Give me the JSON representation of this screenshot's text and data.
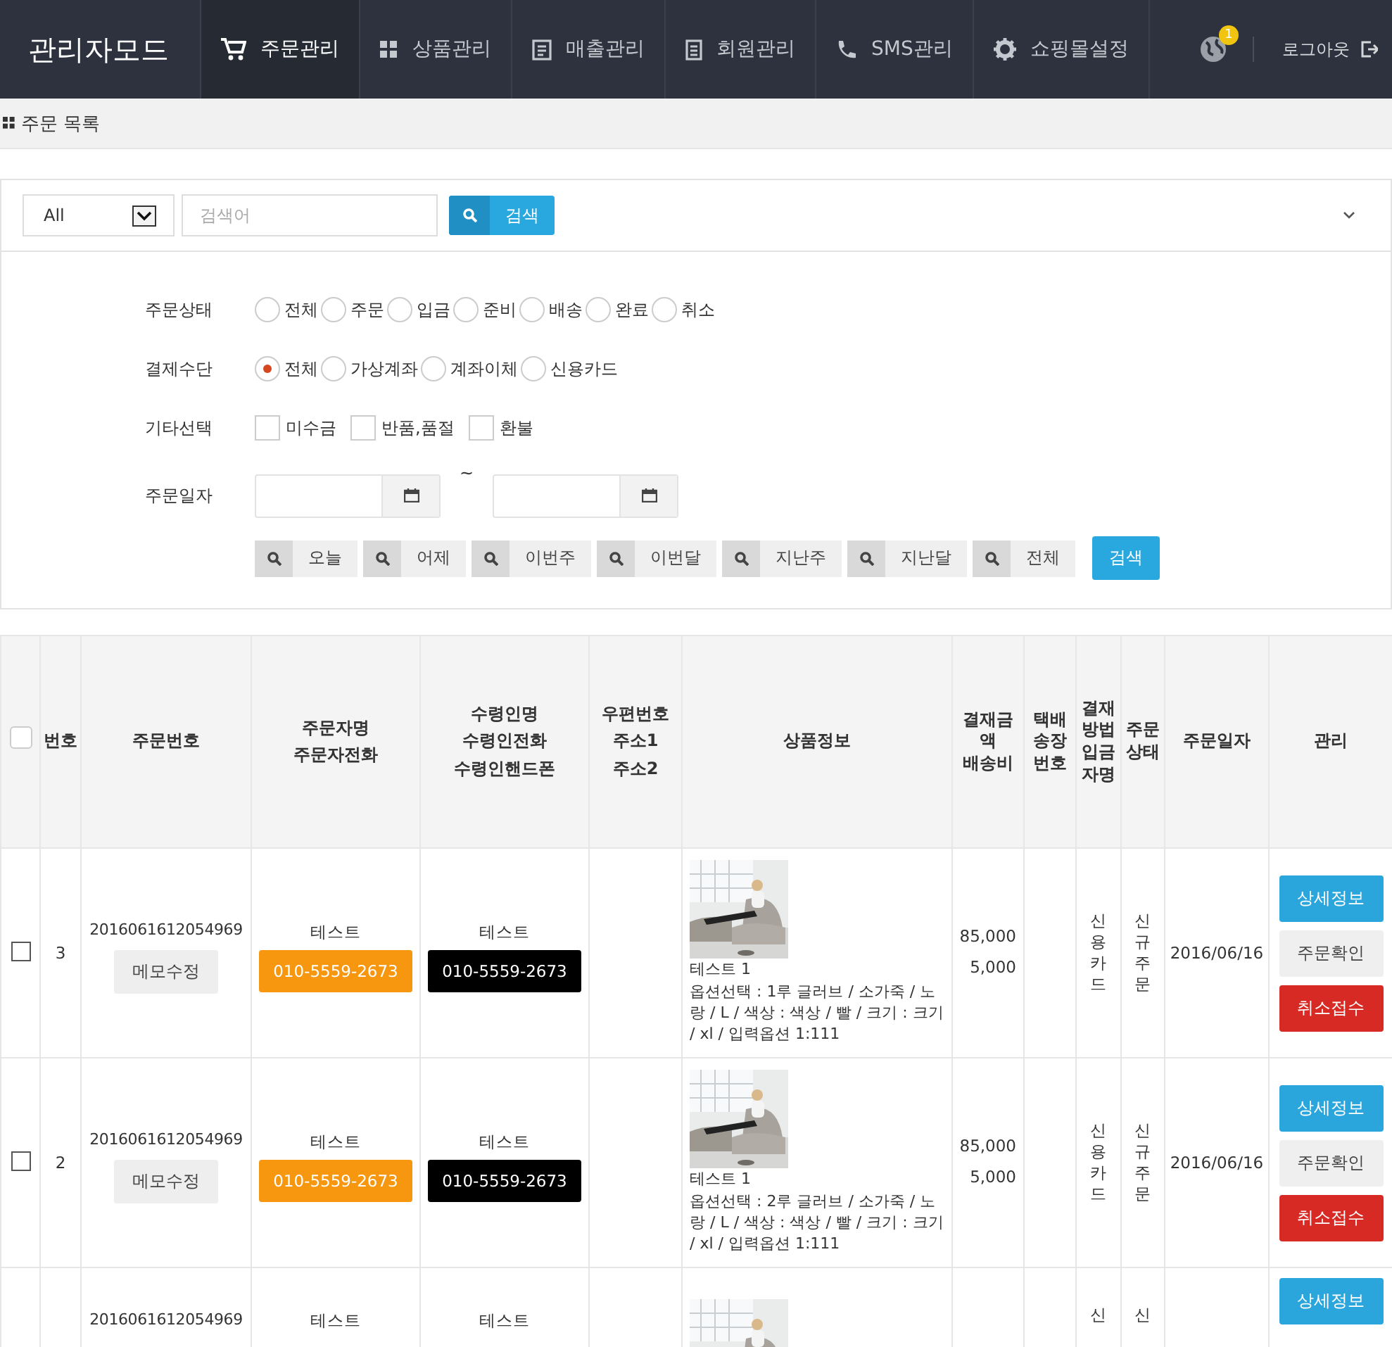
{
  "nav": {
    "brand": "관리자모드",
    "items": [
      {
        "label": "주문관리",
        "selected": true
      },
      {
        "label": "상품관리",
        "selected": false
      },
      {
        "label": "매출관리",
        "selected": false
      },
      {
        "label": "회원관리",
        "selected": false
      },
      {
        "label": "SMS관리",
        "selected": false
      },
      {
        "label": "쇼핑몰설정",
        "selected": false
      }
    ],
    "notification_count": "1",
    "logout": "로그아웃"
  },
  "page_title": "주문 목록",
  "search": {
    "scope": "All",
    "placeholder": "검색어",
    "button": "검색"
  },
  "filters": {
    "order_status": {
      "label": "주문상태",
      "options": [
        {
          "label": "전체",
          "selected": false
        },
        {
          "label": "주문",
          "selected": false
        },
        {
          "label": "입금",
          "selected": false
        },
        {
          "label": "준비",
          "selected": false
        },
        {
          "label": "배송",
          "selected": false
        },
        {
          "label": "완료",
          "selected": false
        },
        {
          "label": "취소",
          "selected": false
        }
      ]
    },
    "payment": {
      "label": "결제수단",
      "options": [
        {
          "label": "전체",
          "selected": true
        },
        {
          "label": "가상계좌",
          "selected": false
        },
        {
          "label": "계좌이체",
          "selected": false
        },
        {
          "label": "신용카드",
          "selected": false
        }
      ]
    },
    "other": {
      "label": "기타선택",
      "options": [
        {
          "label": "미수금",
          "checked": false
        },
        {
          "label": "반품,품절",
          "checked": false
        },
        {
          "label": "환불",
          "checked": false
        }
      ]
    },
    "date": {
      "label": "주문일자",
      "separator": "~"
    },
    "quick_ranges": [
      "오늘",
      "어제",
      "이번주",
      "이번달",
      "지난주",
      "지난달",
      "전체"
    ],
    "search_button": "검색"
  },
  "table": {
    "select_all_checked": false,
    "columns": [
      [
        "번호"
      ],
      [
        "주문번호"
      ],
      [
        "주문자명",
        "주문자전화"
      ],
      [
        "수령인명",
        "수령인전화",
        "수령인핸드폰"
      ],
      [
        "우편번호",
        "주소1",
        "주소2"
      ],
      [
        "상품정보"
      ],
      [
        "결재금액",
        "배송비"
      ],
      [
        "택배송장번호"
      ],
      [
        "결재방법입금자명"
      ],
      [
        "주문상태"
      ],
      [
        "주문일자"
      ],
      [
        "관리"
      ]
    ],
    "rows": [
      {
        "checked": false,
        "no": "3",
        "order_no": "2016061612054969",
        "memo_button": "메모수정",
        "orderer_name": "테스트",
        "orderer_phone": "010-5559-2673",
        "receiver_name": "테스트",
        "receiver_phone": "010-5559-2673",
        "product": {
          "kind": "picture",
          "name": "테스트 1",
          "options": "옵션선택 : 1루 글러브 / 소가죽 / 노랑 / L / 색상 : 색상 / 빨 / 크기 : 크기 / xl / 입력옵션 1:111"
        },
        "amount": "85,000",
        "shipping": "5,000",
        "payment": "신용카드",
        "status": "신규주문",
        "date": "2016/06/16",
        "actions": [
          {
            "kind": "detail",
            "label": "상세정보"
          },
          {
            "kind": "confirm",
            "label": "주문확인"
          },
          {
            "kind": "cancel",
            "label": "취소접수"
          }
        ]
      },
      {
        "checked": false,
        "no": "2",
        "order_no": "2016061612054969",
        "memo_button": "메모수정",
        "orderer_name": "테스트",
        "orderer_phone": "010-5559-2673",
        "receiver_name": "테스트",
        "receiver_phone": "010-5559-2673",
        "product": {
          "kind": "picture",
          "name": "테스트 1",
          "options": "옵션선택 : 2루 글러브 / 소가죽 / 노랑 / L / 색상 : 색상 / 빨 / 크기 : 크기 / xl / 입력옵션 1:111"
        },
        "amount": "85,000",
        "shipping": "5,000",
        "payment": "신용카드",
        "status": "신규주문",
        "date": "2016/06/16",
        "actions": [
          {
            "kind": "detail",
            "label": "상세정보"
          },
          {
            "kind": "confirm",
            "label": "주문확인"
          },
          {
            "kind": "cancel",
            "label": "취소접수"
          }
        ]
      },
      {
        "order_no": "2016061612054969",
        "orderer_name": "테스트",
        "receiver_name": "테스트",
        "product": {
          "kind": "picture"
        },
        "payment": "신",
        "status": "신",
        "actions": [
          {
            "kind": "detail",
            "label": "상세정보"
          }
        ]
      }
    ]
  }
}
